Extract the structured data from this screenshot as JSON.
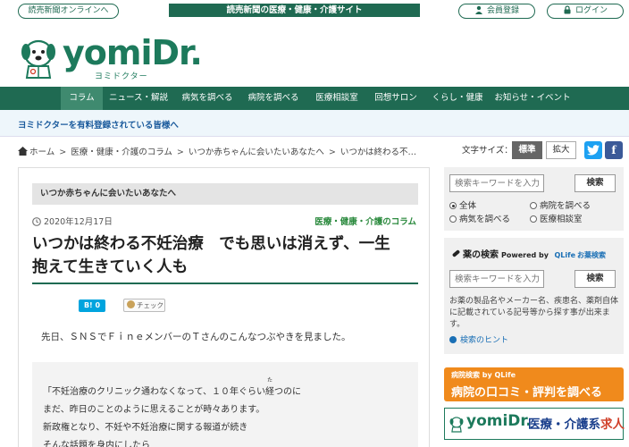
{
  "topbar": {
    "online_label": "読売新聞オンラインへ",
    "site_banner": "読売新聞の医療・健康・介護サイト",
    "member_label": "会員登録",
    "login_label": "ログイン"
  },
  "logo": {
    "name": "yomiDr.",
    "kana": "ヨミドクター"
  },
  "nav": {
    "items": [
      {
        "label": "コラム",
        "active": true
      },
      {
        "label": "ニュース・解説"
      },
      {
        "label": "病気を調べる"
      },
      {
        "label": "病院を調べる"
      },
      {
        "label": "医療相談室"
      },
      {
        "label": "回想サロン"
      },
      {
        "label": "くらし・健康"
      },
      {
        "label": "お知らせ・イベント"
      }
    ]
  },
  "promo": "ヨミドクターを有料登録されている皆様へ",
  "breadcrumb": [
    "ホーム",
    "医療・健康・介護のコラム",
    "いつか赤ちゃんに会いたいあなたへ",
    "いつかは終わる不…"
  ],
  "fontsize": {
    "label": "文字サイズ：",
    "standard": "標準",
    "large": "拡大"
  },
  "sns": {
    "twitter": "t",
    "facebook": "f"
  },
  "article": {
    "series": "いつか赤ちゃんに会いたいあなたへ",
    "date": "2020年12月17日",
    "category": "医療・健康・介護のコラム",
    "title_line1": "いつかは終わる不妊治療　でも思いは消えず、一生",
    "title_line2": "抱えて生きていく人も",
    "hatena_label": "B! 0",
    "mixi_label": "チェック",
    "lead": "先日、ＳＮＳでＦｉｎｅメンバーのＴさんのこんなつぶやきを見ました。",
    "quote": {
      "line1_before": "「不妊治療のクリニック通わなくなって、１０年ぐらい",
      "line1_ruby_base": "経",
      "line1_ruby_text": "た",
      "line1_after": "つのに",
      "line2": "まだ、昨日のことのように思えることが時々あります。",
      "line3": "新政権となり、不妊や不妊治療に関する報道が続き",
      "line4": "そんな話題を身内にしたら"
    }
  },
  "sidebar": {
    "search": {
      "placeholder": "検索キーワードを入力",
      "button": "検索",
      "options": [
        {
          "label": "全体",
          "checked": true
        },
        {
          "label": "病院を調べる"
        },
        {
          "label": "病気を調べる"
        },
        {
          "label": "医療相談室"
        }
      ]
    },
    "drug": {
      "heading": "薬の検索",
      "powered": "Powered by",
      "qlife": "QLife",
      "okusuri": "お薬検索",
      "placeholder": "検索キーワードを入力",
      "button": "検索",
      "description": "お薬の製品名やメーカー名、疾患名、薬剤自体に記載されている記号等から探す事が出来ます。",
      "hint": "検索のヒント"
    },
    "banner_hospital": {
      "small": "病院検索 by QLife",
      "big": "病院の口コミ・評判を調べる"
    },
    "banner_jobs": {
      "logo": "yomiDr.",
      "text_main": "医療・介護系",
      "text_accent": "求人"
    }
  },
  "colors": {
    "brand_green": "#1f6a52",
    "category_green": "#2b8a3e",
    "link_blue": "#1a6fb5",
    "orange": "#f08a1c"
  }
}
